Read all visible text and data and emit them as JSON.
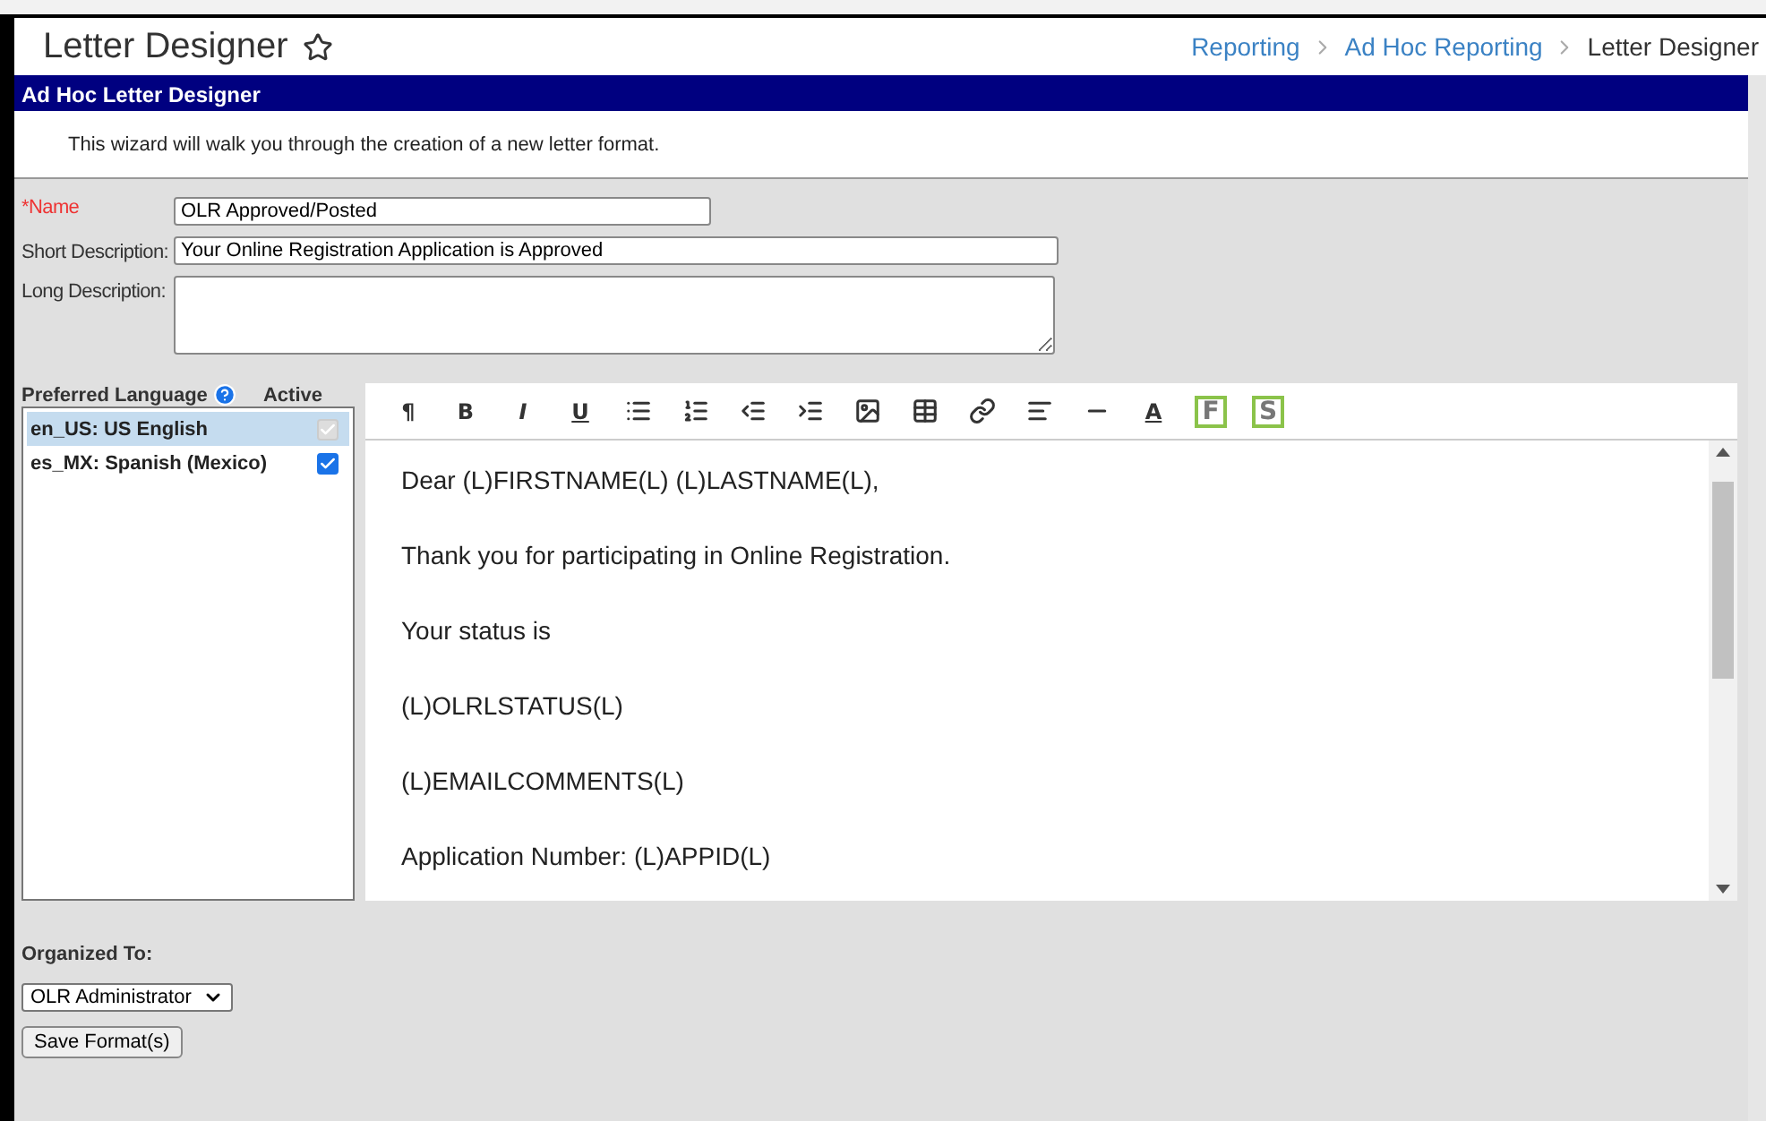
{
  "header": {
    "title": "Letter Designer",
    "breadcrumbs": [
      {
        "label": "Reporting",
        "link": true
      },
      {
        "label": "Ad Hoc Reporting",
        "link": true
      },
      {
        "label": "Letter Designer",
        "link": false
      }
    ]
  },
  "panel": {
    "title": "Ad Hoc Letter Designer",
    "intro": "This wizard will walk you through the creation of a new letter format."
  },
  "fields": [
    {
      "kind": "input",
      "label": "*Name",
      "required": true,
      "value": "OLR Approved/Posted"
    },
    {
      "kind": "input",
      "label": "Short Description:",
      "required": false,
      "value": "Your Online Registration Application is Approved"
    },
    {
      "kind": "textarea",
      "label": "Long Description:",
      "required": false
    }
  ],
  "languages": {
    "column_1": "Preferred Language",
    "column_2": "Active",
    "items": [
      {
        "label": "en_US: US English",
        "selected": true,
        "checked": true,
        "disabled": true
      },
      {
        "label": "es_MX: Spanish (Mexico)",
        "selected": false,
        "checked": true,
        "disabled": false
      }
    ]
  },
  "toolbar": [
    {
      "kind": "plain",
      "label": "¶"
    },
    {
      "kind": "plain",
      "label": "B"
    },
    {
      "kind": "italic",
      "label": "I"
    },
    {
      "kind": "underline",
      "label": "U"
    },
    {
      "kind": "bullets"
    },
    {
      "kind": "numbers"
    },
    {
      "kind": "outdent"
    },
    {
      "kind": "indent"
    },
    {
      "kind": "image"
    },
    {
      "kind": "table"
    },
    {
      "kind": "link"
    },
    {
      "kind": "align"
    },
    {
      "kind": "rule"
    },
    {
      "kind": "underline",
      "label": "A"
    },
    {
      "kind": "boxed",
      "label": "F"
    },
    {
      "kind": "boxed",
      "label": "S"
    }
  ],
  "editor": {
    "paragraphs": [
      "Dear  (L)FIRSTNAME(L) (L)LASTNAME(L),",
      "Thank you for participating in Online Registration.",
      "Your status is",
      "(L)OLRLSTATUS(L)",
      "(L)EMAILCOMMENTS(L)",
      "Application Number: (L)APPID(L)"
    ]
  },
  "organized": {
    "label": "Organized To:",
    "value": "OLR Administrator"
  },
  "save_button": "Save Format(s)"
}
